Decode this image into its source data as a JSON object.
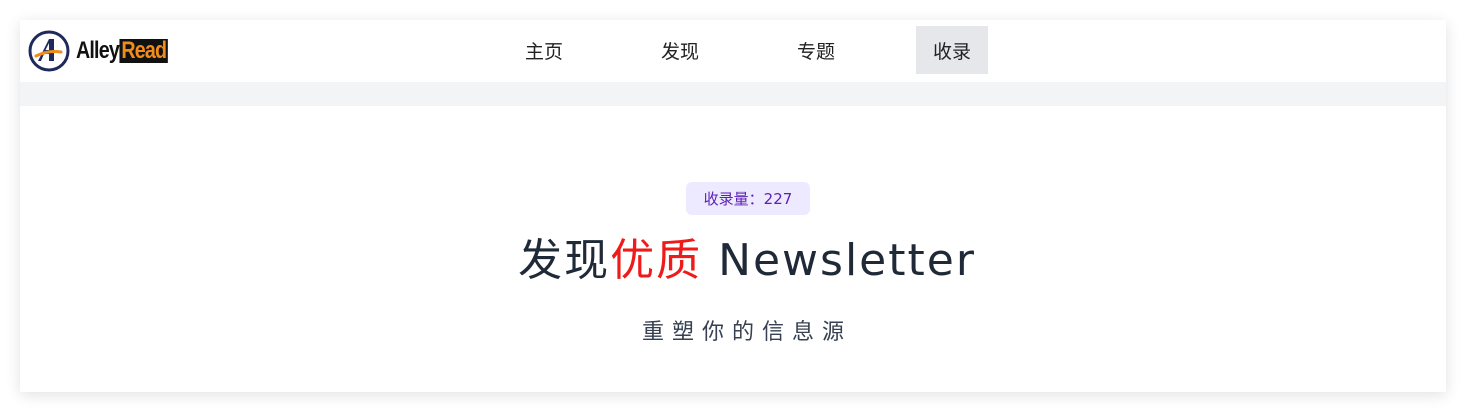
{
  "brand": {
    "logo_icon": "alleyread-a-logo",
    "name_part1": "Alley",
    "name_part2": "Read",
    "colors": {
      "dark": "#111111",
      "accent": "#f08c1a",
      "navy": "#1f2a5c"
    }
  },
  "nav": {
    "items": [
      {
        "label": "主页",
        "active": false
      },
      {
        "label": "发现",
        "active": false
      },
      {
        "label": "专题",
        "active": false
      },
      {
        "label": "收录",
        "active": true
      }
    ],
    "active_bg": "#e5e7eb"
  },
  "hero": {
    "badge": "收录量：227",
    "badge_colors": {
      "bg": "#ede9fe",
      "text": "#5b21b6"
    },
    "title_prefix": "发现",
    "title_highlight": "优质",
    "title_suffix": " Newsletter",
    "highlight_color": "#ef1b1b",
    "subtitle": "重塑你的信息源"
  }
}
